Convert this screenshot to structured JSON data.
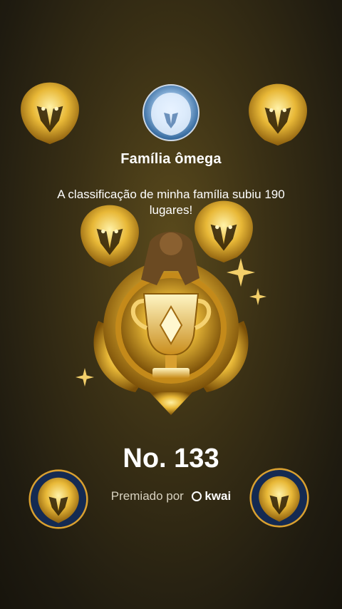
{
  "family_name": "Família ômega",
  "message": "A classificação de minha família subiu 190 lugares!",
  "rank_label": "No. 133",
  "awarded_by_text": "Premiado por",
  "brand_name": "kwai",
  "colors": {
    "gold": "#e8b837",
    "dark_gold": "#9a6a10",
    "badge_navy": "#142a52"
  },
  "icons": [
    "lion-icon",
    "trophy-icon",
    "sparkle-icon",
    "kwai-logo-icon"
  ]
}
